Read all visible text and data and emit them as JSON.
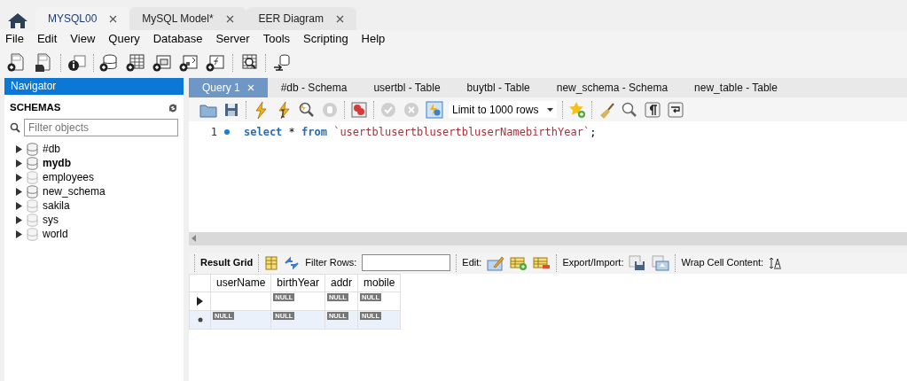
{
  "app_tabs": [
    {
      "label": "MYSQL00",
      "selected": true
    },
    {
      "label": "MySQL Model*",
      "selected": false
    },
    {
      "label": "EER Diagram",
      "selected": false
    }
  ],
  "menu": [
    "File",
    "Edit",
    "View",
    "Query",
    "Database",
    "Server",
    "Tools",
    "Scripting",
    "Help"
  ],
  "navigator": {
    "title": "Navigator",
    "section": "SCHEMAS",
    "filter_placeholder": "Filter objects",
    "schemas": [
      {
        "name": "#db",
        "default": false,
        "loaded": true,
        "expanded": false
      },
      {
        "name": "mydb",
        "default": true,
        "loaded": true,
        "expanded": false
      },
      {
        "name": "employees",
        "default": false,
        "loaded": false,
        "expanded": false
      },
      {
        "name": "new_schema",
        "default": false,
        "loaded": true,
        "expanded": false
      },
      {
        "name": "sakila",
        "default": false,
        "loaded": false,
        "expanded": false
      },
      {
        "name": "sys",
        "default": false,
        "loaded": false,
        "expanded": false
      },
      {
        "name": "world",
        "default": false,
        "loaded": false,
        "expanded": false
      }
    ]
  },
  "editor_tabs": [
    {
      "label": "Query 1",
      "selected": true
    },
    {
      "label": "#db - Schema",
      "selected": false
    },
    {
      "label": "usertbl - Table",
      "selected": false
    },
    {
      "label": "buytbl - Table",
      "selected": false
    },
    {
      "label": "new_schema - Schema",
      "selected": false
    },
    {
      "label": "new_table - Table",
      "selected": false
    }
  ],
  "limit_select": "Limit to 1000 rows",
  "editor_lines": [
    {
      "number": "1",
      "segments": [
        {
          "kind": "keyword",
          "text": "select"
        },
        {
          "kind": "plain",
          "text": " * "
        },
        {
          "kind": "keyword",
          "text": "from"
        },
        {
          "kind": "identifier",
          "text": "`usertblusertblusertbluserNamebirthYear`"
        },
        {
          "kind": "plain",
          "text": ";"
        }
      ]
    }
  ],
  "result": {
    "tab": "Result Grid",
    "filter_label": "Filter Rows:",
    "edit_label": "Edit:",
    "export_label": "Export/Import:",
    "wrap_label": "Wrap Cell Content:",
    "columns": [
      "userName",
      "birthYear",
      "addr",
      "mobile"
    ],
    "rows": [
      {
        "kind": "current",
        "cells": [
          null,
          "NULL",
          "NULL",
          "NULL"
        ]
      },
      {
        "kind": "new",
        "cells": [
          "NULL",
          "NULL",
          "NULL",
          "NULL"
        ]
      }
    ]
  }
}
